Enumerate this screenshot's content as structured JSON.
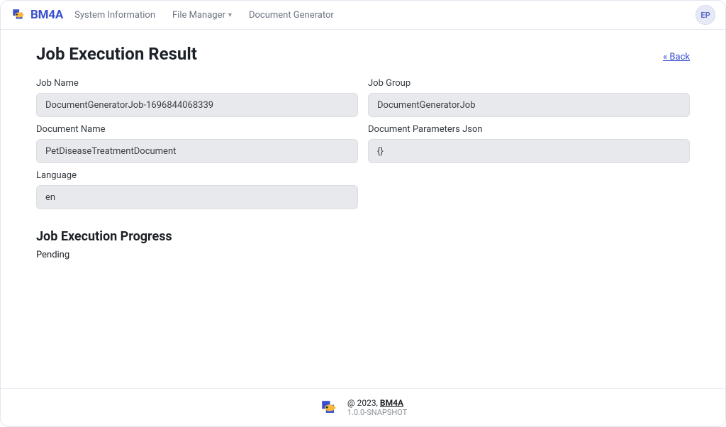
{
  "brand": {
    "name": "BM4A"
  },
  "nav": {
    "system_information": "System Information",
    "file_manager": "File Manager",
    "document_generator": "Document Generator"
  },
  "avatar": {
    "initials": "EP"
  },
  "page": {
    "title": "Job Execution Result",
    "back_label": "« Back",
    "fields": {
      "job_name": {
        "label": "Job Name",
        "value": "DocumentGeneratorJob-1696844068339"
      },
      "job_group": {
        "label": "Job Group",
        "value": "DocumentGeneratorJob"
      },
      "document_name": {
        "label": "Document Name",
        "value": "PetDiseaseTreatmentDocument"
      },
      "document_params": {
        "label": "Document Parameters Json",
        "value": "{}"
      },
      "language": {
        "label": "Language",
        "value": "en"
      }
    },
    "progress": {
      "heading": "Job Execution Progress",
      "status": "Pending"
    }
  },
  "footer": {
    "copyright_prefix": "@ 2023, ",
    "brand": "BM4A",
    "version": "1.0.0-SNAPSHOT"
  }
}
